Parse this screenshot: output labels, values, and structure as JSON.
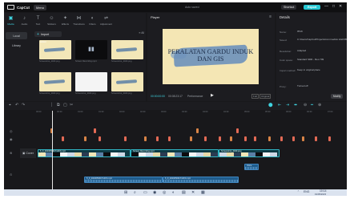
{
  "titlebar": {
    "app_name": "CapCut",
    "menu_label": "Menu",
    "autosave_text": "Auto saved",
    "shortcut_label": "Shortcut",
    "export_label": "Export",
    "window_controls": [
      "—",
      "□",
      "✕"
    ]
  },
  "toolbar_tabs": [
    {
      "label": "Media",
      "icon": "media-icon",
      "glyph": "▣"
    },
    {
      "label": "Audio",
      "icon": "audio-icon",
      "glyph": "♪"
    },
    {
      "label": "Text",
      "icon": "text-icon",
      "glyph": "T"
    },
    {
      "label": "Stickers",
      "icon": "sticker-icon",
      "glyph": "☺"
    },
    {
      "label": "Effects",
      "icon": "effects-icon",
      "glyph": "✦"
    },
    {
      "label": "Transitions",
      "icon": "transitions-icon",
      "glyph": "⋈"
    },
    {
      "label": "Filters",
      "icon": "filters-icon",
      "glyph": "◐"
    },
    {
      "label": "Adjustment",
      "icon": "adjustment-icon",
      "glyph": "⇌"
    }
  ],
  "side_nav": [
    "Local",
    "Library"
  ],
  "media": {
    "import_label": "Import",
    "sort_label": "All",
    "thumbnails": [
      {
        "kind": "beige",
        "badge": "Added",
        "caption": "Screenshot_2023.png"
      },
      {
        "kind": "dark",
        "badge": "",
        "caption": "Screen Recording.mp4"
      },
      {
        "kind": "beige",
        "badge": "",
        "caption": "Screenshot_2023.png"
      },
      {
        "kind": "beige",
        "badge": "",
        "caption": "Screenshot_2023.png"
      },
      {
        "kind": "white",
        "badge": "",
        "caption": "Screenshot_2023.png"
      },
      {
        "kind": "beige",
        "badge": "",
        "caption": "Screenshot_2023.png"
      }
    ]
  },
  "player": {
    "header": "Player",
    "menu_glyph": "≡",
    "slide_title": "PERALATAN GARDU INDUK DAN GIS",
    "timecode_current": "00:00:00:00",
    "timecode_total": "00:08:23:17",
    "performance_label": "Performance",
    "full_label": "Full",
    "ratio_label": "Original"
  },
  "details": {
    "header": "Details",
    "rows": [
      {
        "key": "Name:",
        "value": "0519"
      },
      {
        "key": "Saved:",
        "value": "C:/Users/CapCut/Projects/com.lveditor.draft/0519"
      },
      {
        "key": "Resolution:",
        "value": "Adapted"
      },
      {
        "key": "Color space:",
        "value": "Standard SDR - Rec.709"
      },
      {
        "key": "Import method:",
        "value": "Keep in original place"
      },
      {
        "key": "Proxy:",
        "value": "Turned off"
      }
    ],
    "modify_label": "Modify"
  },
  "timeline_toolbar": {
    "left_tools": [
      "⌖",
      "↶",
      "↷",
      "⏐",
      "⧉",
      "▢",
      "✂"
    ],
    "right_tools": [
      "⬤",
      "⇤",
      "⇥",
      "⬌",
      "⊖",
      "━",
      "⊕"
    ]
  },
  "timeline": {
    "ruler": [
      "00:00",
      "00:30",
      "01:00",
      "01:30",
      "02:00",
      "02:30",
      "03:00",
      "03:30",
      "04:00",
      "04:30",
      "05:00",
      "05:30",
      "06:00",
      "06:30",
      "07:00"
    ],
    "cover_label": "Cover",
    "lane_icons": [
      "◎",
      "◉",
      "⊗",
      "⊙"
    ],
    "main_clips": [
      {
        "label": "6_0_20230509171415.mp4",
        "kind": "main"
      },
      {
        "label": "Screen Recording.mp4",
        "kind": "main"
      },
      {
        "label": "Screenshot_2023.png",
        "kind": "main"
      }
    ],
    "audio_clips": [
      {
        "label": "6_0_20230509171415.mp4"
      },
      {
        "label": "6_0_20230509171415.mp4"
      },
      {
        "label": "Voice"
      }
    ]
  },
  "taskbar": {
    "time": "10:14",
    "date": "19/05/2023",
    "lang": "ENG"
  }
}
